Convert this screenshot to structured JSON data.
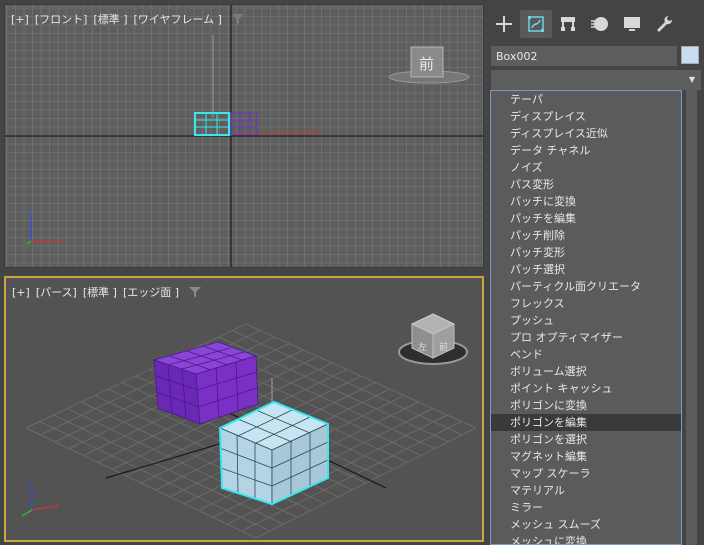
{
  "viewports": {
    "front": {
      "labels": [
        "[+]",
        "[フロント]",
        "[標準 ]",
        "[ワイヤフレーム ]"
      ]
    },
    "perspective": {
      "labels": [
        "[+]",
        "[パース]",
        "[標準 ]",
        "[エッジ面 ]"
      ]
    },
    "viewcube_front_label": "前"
  },
  "panel": {
    "tabs": [
      {
        "icon": "create-plus-icon"
      },
      {
        "icon": "modify-icon"
      },
      {
        "icon": "hierarchy-icon"
      },
      {
        "icon": "motion-icon"
      },
      {
        "icon": "display-icon"
      },
      {
        "icon": "utilities-wrench-icon"
      }
    ],
    "object_name": "Box002",
    "object_color": "#c9dcf4",
    "modifier_dropdown_value": "",
    "modifiers": [
      "テーパ",
      "ディスプレイス",
      "ディスプレイス近似",
      "データ チャネル",
      "ノイズ",
      "パス変形",
      "パッチに変換",
      "パッチを編集",
      "パッチ削除",
      "パッチ変形",
      "パッチ選択",
      "パーティクル面クリエータ",
      "フレックス",
      "プッシュ",
      "プロ オプティマイザー",
      "ベンド",
      "ボリューム選択",
      "ポイント キャッシュ",
      "ポリゴンに変換",
      "ポリゴンを編集",
      "ポリゴンを選択",
      "マグネット編集",
      "マップ スケーラ",
      "マテリアル",
      "ミラー",
      "メッシュ スムーズ",
      "メッシュに変換"
    ],
    "selected_modifier": "ポリゴンを編集"
  },
  "colors": {
    "selection_cyan": "#38e8f0",
    "purple_box": "#7a2fc2",
    "active_viewport_border": "#c6a83e"
  }
}
